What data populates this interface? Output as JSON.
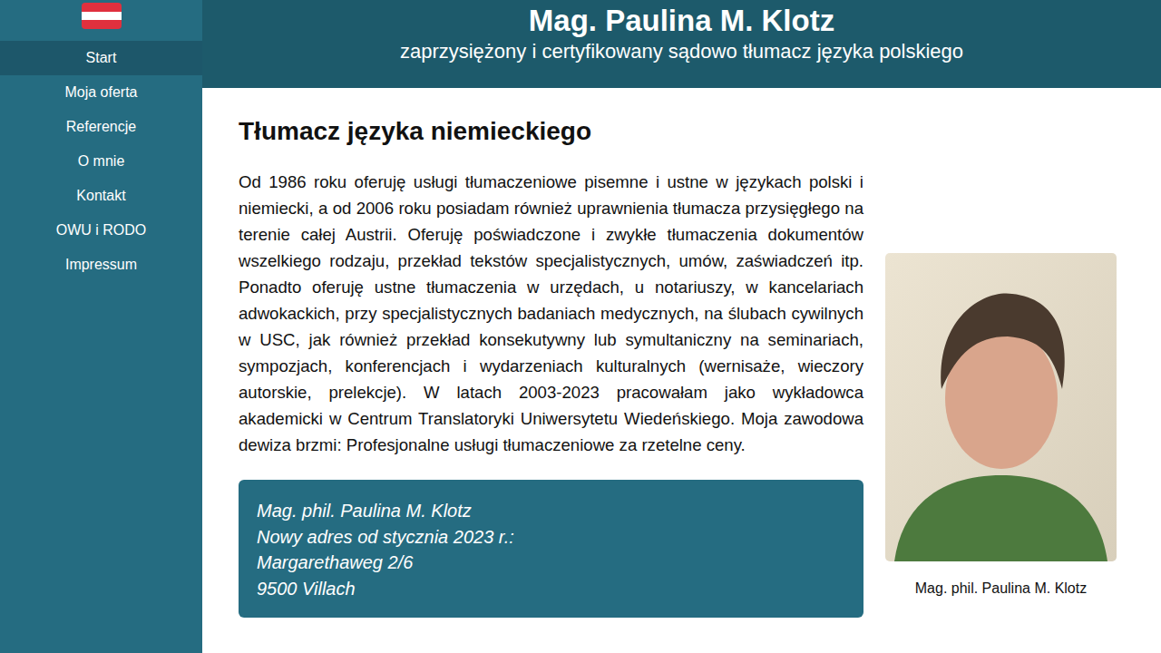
{
  "sidebar": {
    "items": [
      {
        "label": "Start",
        "selected": true
      },
      {
        "label": "Moja oferta",
        "selected": false
      },
      {
        "label": "Referencje",
        "selected": false
      },
      {
        "label": "O mnie",
        "selected": false
      },
      {
        "label": "Kontakt",
        "selected": false
      },
      {
        "label": "OWU i RODO",
        "selected": false
      },
      {
        "label": "Impressum",
        "selected": false
      }
    ]
  },
  "header": {
    "title": "Mag. Paulina M. Klotz",
    "subtitle": "zaprzysiężony i certyfikowany sądowo tłumacz języka polskiego"
  },
  "main": {
    "heading": "Tłumacz języka niemieckiego",
    "paragraph": "Od 1986 roku oferuję usługi tłumaczeniowe pisemne i ustne w językach polski i niemiecki, a od 2006 roku posiadam również uprawnienia tłumacza przysięgłego na terenie całej Austrii. Oferuję poświadczone i zwykłe tłumaczenia dokumentów wszelkiego rodzaju, przekład tekstów specjalistycznych, umów, zaświadczeń itp. Ponadto oferuję ustne tłumaczenia w urzędach, u notariuszy, w kancelariach adwokackich, przy specjalistycznych badaniach medycznych, na ślubach cywilnych w USC, jak również przekład konsekutywny lub symultaniczny na seminariach, sympozjach, konferencjach i wydarzeniach kulturalnych (wernisaże, wieczory autorskie, prelekcje). W latach 2003-2023 pracowałam jako wykładowca akademicki w Centrum Translatoryki Uniwersytetu Wiedeńskiego. Moja zawodowa dewiza brzmi: Profesjonalne usługi tłumaczeniowe za rzetelne ceny.",
    "address_box": {
      "lines": [
        "Mag. phil. Paulina M. Klotz",
        "Nowy adres od stycznia 2023 r.:",
        "Margarethaweg 2/6",
        "9500 Villach"
      ]
    },
    "photo": {
      "caption": "Mag. phil. Paulina M. Klotz"
    }
  }
}
